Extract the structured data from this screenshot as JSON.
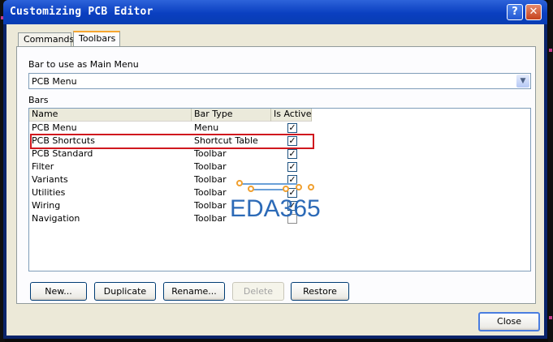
{
  "window": {
    "title": "Customizing PCB Editor",
    "help_glyph": "?",
    "close_glyph": "✕"
  },
  "tabs": [
    {
      "label": "Commands",
      "active": false
    },
    {
      "label": "Toolbars",
      "active": true
    }
  ],
  "main_menu": {
    "label": "Bar to use as Main Menu",
    "selected": "PCB Menu",
    "arrow_icon": "chevron-down-icon"
  },
  "bars": {
    "label": "Bars",
    "columns": [
      "Name",
      "Bar Type",
      "Is Active"
    ],
    "rows": [
      {
        "name": "PCB Menu",
        "type": "Menu",
        "active": true
      },
      {
        "name": "PCB Shortcuts",
        "type": "Shortcut Table",
        "active": true
      },
      {
        "name": "PCB Standard",
        "type": "Toolbar",
        "active": true
      },
      {
        "name": "Filter",
        "type": "Toolbar",
        "active": true
      },
      {
        "name": "Variants",
        "type": "Toolbar",
        "active": true
      },
      {
        "name": "Utilities",
        "type": "Toolbar",
        "active": true
      },
      {
        "name": "Wiring",
        "type": "Toolbar",
        "active": true
      },
      {
        "name": "Navigation",
        "type": "Toolbar",
        "active": false
      }
    ],
    "check_glyph": "✓"
  },
  "buttons": {
    "new": "New...",
    "duplicate": "Duplicate",
    "rename": "Rename...",
    "delete": "Delete",
    "restore": "Restore",
    "close": "Close"
  },
  "watermark": "EDA365",
  "colors": {
    "highlight_box": "#d0181e",
    "titlebar": "#0a3fc0",
    "watermark": "#2c6ab7"
  }
}
